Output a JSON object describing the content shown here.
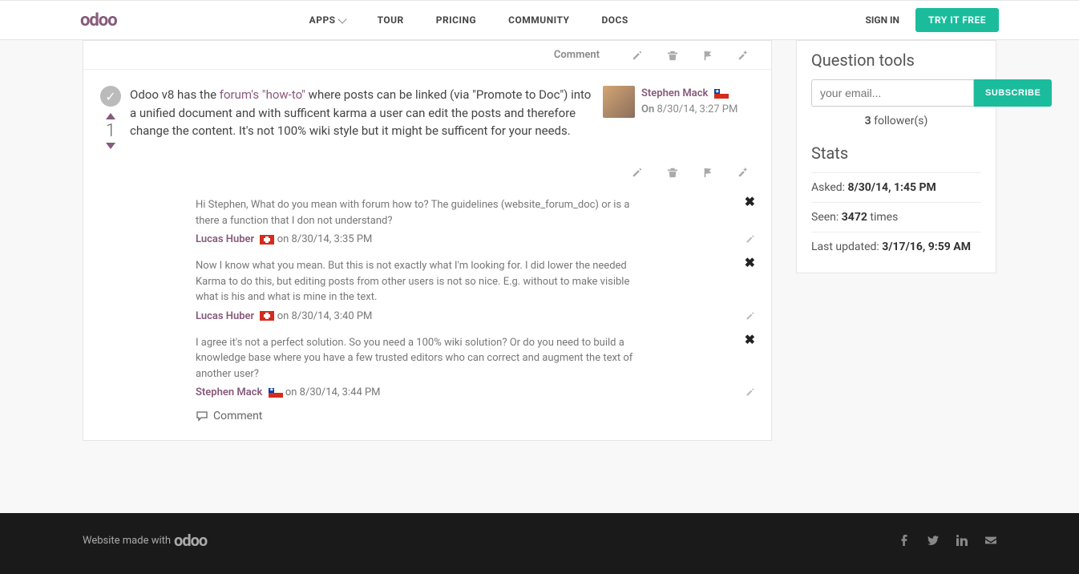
{
  "nav": {
    "apps": "APPS",
    "tour": "TOUR",
    "pricing": "PRICING",
    "community": "COMMUNITY",
    "docs": "DOCS",
    "signin": "SIGN IN",
    "tryfree": "TRY IT FREE"
  },
  "logo": "odoo",
  "topPost": {
    "commentLabel": "Comment"
  },
  "answer": {
    "votes": "1",
    "text_prefix": "Odoo v8 has the ",
    "text_link": "forum's \"how-to\"",
    "text_suffix": " where posts can be linked (via \"Promote to Doc\") into a unified document and with sufficent karma a user can edit the posts and therefore change the content.  It's not 100% wiki style but it might be sufficent for your needs.",
    "author": "Stephen Mack",
    "on_label": "On",
    "on_date": "8/30/14, 3:27 PM"
  },
  "comments": [
    {
      "text": "Hi Stephen, What do you mean with forum how to? The guidelines (website_forum_doc) or is a there a function that I don not understand?",
      "author": "Lucas Huber",
      "flag": "swiss",
      "date": "on 8/30/14, 3:35 PM"
    },
    {
      "text": "Now I know what you mean. But this is not exactly what I'm looking for. I did lower the needed Karma to do this, but editing posts from other users is not so nice. E.g. without to make visible what is his and what is mine in the text.",
      "author": "Lucas Huber",
      "flag": "swiss",
      "date": "on 8/30/14, 3:40 PM"
    },
    {
      "text": "I agree it's not a perfect solution. So you need a 100% wiki solution? Or do you need to build a knowledge base where you have a few trusted editors who can correct and augment the text of another user?",
      "author": "Stephen Mack",
      "flag": "chile",
      "date": "on 8/30/14, 3:44 PM"
    }
  ],
  "addComment": "Comment",
  "sidebar": {
    "qtools": "Question tools",
    "emailPlaceholder": "your email...",
    "subscribe": "SUBSCRIBE",
    "followers_num": "3",
    "followers_txt": " follower(s)",
    "stats": "Stats",
    "asked_label": "Asked: ",
    "asked_val": "8/30/14, 1:45 PM",
    "seen_label": "Seen: ",
    "seen_val": "3472",
    "seen_suffix": " times",
    "updated_label": "Last updated: ",
    "updated_val": "3/17/16, 9:59 AM"
  },
  "footer": {
    "text": "Website made with ",
    "logo": "odoo"
  }
}
